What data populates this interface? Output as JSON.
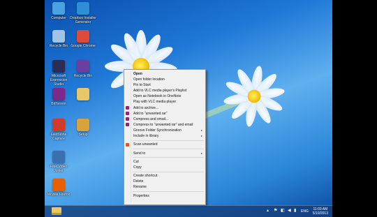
{
  "desktop": {
    "icons": [
      {
        "label": "Computer",
        "icon": "computer-icon",
        "color": "#4aa3e0"
      },
      {
        "label": "Dropbox Installer Generator",
        "icon": "dropbox-installer-icon",
        "color": "#2d8fd5"
      },
      {
        "label": "Recycle Bin",
        "icon": "recycle-bin-icon",
        "color": "#9fc4e6"
      },
      {
        "label": "Google Chrome",
        "icon": "chrome-icon",
        "color": "#dd4b39"
      },
      {
        "label": "Microsoft Expression Studio",
        "icon": "expression-icon",
        "color": "#2c2c54"
      },
      {
        "label": "Recycle Bin",
        "icon": "purple-app-icon",
        "color": "#6b3fa0"
      },
      {
        "label": "BitTorrent",
        "icon": "bittorrent-icon",
        "color": "#7a2a8c"
      },
      {
        "label": "",
        "icon": "folder-icon",
        "color": "#e8c766"
      },
      {
        "label": "FastStone Capture",
        "icon": "faststone-icon",
        "color": "#d23a2a"
      },
      {
        "label": "Setup",
        "icon": "winrar-archive-icon",
        "color": "#d9a23a"
      },
      {
        "label": "Free Video Joiner",
        "icon": "video-joiner-icon",
        "color": "#3a6fb0"
      },
      {
        "label": "Mozilla Firefox",
        "icon": "firefox-icon",
        "color": "#e66000"
      }
    ]
  },
  "context_menu": {
    "items": [
      {
        "type": "item",
        "label": "Open",
        "bold": true
      },
      {
        "type": "item",
        "label": "Open folder location"
      },
      {
        "type": "item",
        "label": "Pin to Start"
      },
      {
        "type": "item",
        "label": "Add to VLC media player's Playlist"
      },
      {
        "type": "item",
        "label": "Open as Notebook in OneNote"
      },
      {
        "type": "item",
        "label": "Play with VLC media player"
      },
      {
        "type": "item",
        "label": "Add to archive...",
        "icon": "winrar-icon",
        "color": "#8b2a6b"
      },
      {
        "type": "item",
        "label": "Add to \"unwanted.rar\"",
        "icon": "winrar-icon",
        "color": "#8b2a6b"
      },
      {
        "type": "item",
        "label": "Compress and email...",
        "icon": "winrar-icon",
        "color": "#8b2a6b"
      },
      {
        "type": "item",
        "label": "Compress to \"unwanted.rar\" and email",
        "icon": "winrar-icon",
        "color": "#8b2a6b"
      },
      {
        "type": "item",
        "label": "Groove Folder Synchronization",
        "submenu": true
      },
      {
        "type": "item",
        "label": "Include in library",
        "submenu": true
      },
      {
        "type": "sep"
      },
      {
        "type": "item",
        "label": "Scan unwanted",
        "icon": "antivirus-icon",
        "color": "#e2572a"
      },
      {
        "type": "sep"
      },
      {
        "type": "item",
        "label": "Send to",
        "submenu": true
      },
      {
        "type": "sep"
      },
      {
        "type": "item",
        "label": "Cut"
      },
      {
        "type": "item",
        "label": "Copy"
      },
      {
        "type": "sep"
      },
      {
        "type": "item",
        "label": "Create shortcut"
      },
      {
        "type": "item",
        "label": "Delete"
      },
      {
        "type": "item",
        "label": "Rename"
      },
      {
        "type": "sep"
      },
      {
        "type": "item",
        "label": "Properties"
      }
    ],
    "submenu_arrow": "▸"
  },
  "taskbar": {
    "tray_icons": [
      "chevron-up-icon",
      "flag-icon",
      "network-icon",
      "volume-icon",
      "battery-icon"
    ],
    "tray_glyphs": [
      "▴",
      "⚑",
      "◧",
      "◀",
      "▮"
    ],
    "language": "ENG",
    "time": "11:03 AM",
    "date": "5/10/2013"
  },
  "colors": {
    "accent": "#1f78d6",
    "menu_bg": "#f0f0f0",
    "taskbar": "#143c78"
  }
}
